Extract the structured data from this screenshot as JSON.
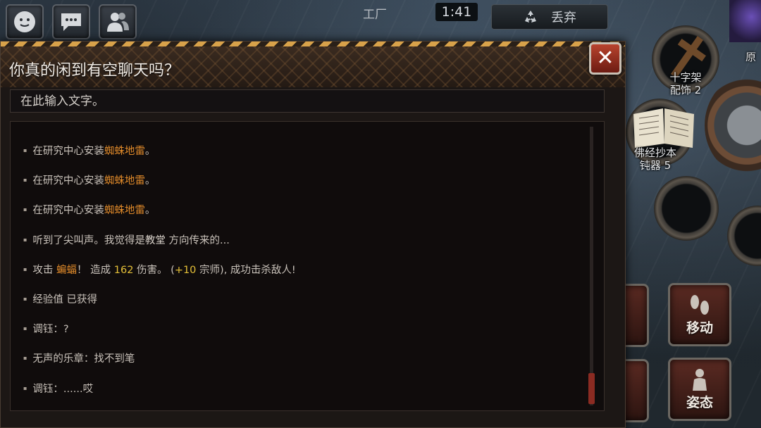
{
  "hud": {
    "location": "工厂",
    "timer": "1:41",
    "discard_label": "丢弃",
    "right_top_label": "原"
  },
  "scene_items": {
    "cross": {
      "line1": "十字架",
      "line2": "配饰 2"
    },
    "scripture": {
      "line1": "佛经抄本",
      "line2": "钝器 5"
    }
  },
  "actions": {
    "move": "移动",
    "posture": "姿态"
  },
  "dialog": {
    "title": "你真的闲到有空聊天吗？",
    "input_placeholder": "在此输入文字。",
    "messages": [
      {
        "parts": [
          {
            "t": "在研究中心安装"
          },
          {
            "t": "蜘蛛地雷",
            "c": "hl-orange"
          },
          {
            "t": "。"
          }
        ]
      },
      {
        "parts": [
          {
            "t": "在研究中心安装"
          },
          {
            "t": "蜘蛛地雷",
            "c": "hl-orange"
          },
          {
            "t": "。"
          }
        ]
      },
      {
        "parts": [
          {
            "t": "在研究中心安装"
          },
          {
            "t": "蜘蛛地雷",
            "c": "hl-orange"
          },
          {
            "t": "。"
          }
        ]
      },
      {
        "parts": [
          {
            "t": "听到了尖叫声。我觉得是"
          },
          {
            "t": "教堂",
            "c": "hl-plain"
          },
          {
            "t": " 方向传来的..."
          }
        ]
      },
      {
        "parts": [
          {
            "t": "攻击 "
          },
          {
            "t": "蝙蝠",
            "c": "hl-orange"
          },
          {
            "t": "！ 造成 "
          },
          {
            "t": "162",
            "c": "hl-yellow"
          },
          {
            "t": " 伤害。 ("
          },
          {
            "t": "+10",
            "c": "hl-yellow"
          },
          {
            "t": " 宗师), 成功击杀敌人!"
          }
        ]
      },
      {
        "parts": [
          {
            "t": "经验值 已获得"
          }
        ]
      },
      {
        "parts": [
          {
            "t": "调钰：?"
          }
        ]
      },
      {
        "parts": [
          {
            "t": "无声的乐章：找不到笔"
          }
        ]
      },
      {
        "parts": [
          {
            "t": "调钰：......哎"
          }
        ]
      }
    ]
  },
  "colors": {
    "highlight_orange": "#e08a2a",
    "highlight_yellow": "#e5c038",
    "close_button": "#b8432e",
    "hazard_stripe": "#d8a24a"
  }
}
